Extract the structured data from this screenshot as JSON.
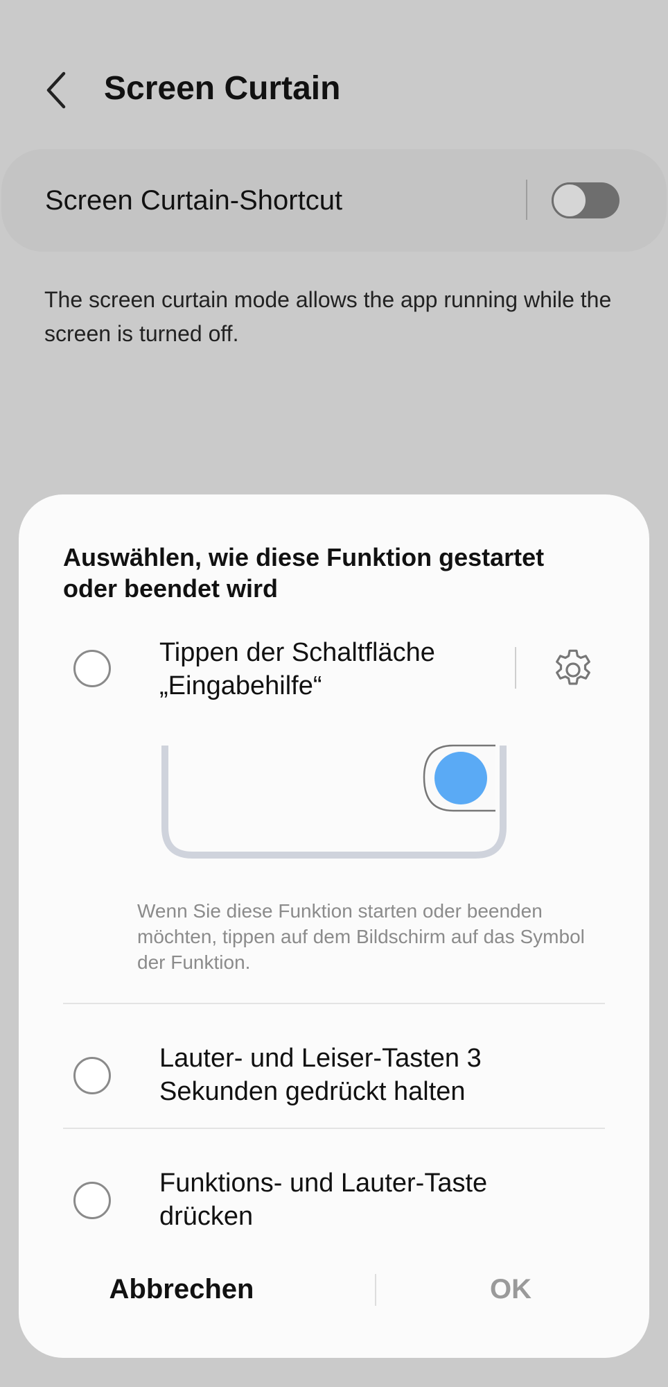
{
  "header": {
    "title": "Screen Curtain",
    "back_icon": "chevron-left-icon"
  },
  "shortcut": {
    "label": "Screen Curtain-Shortcut",
    "toggle_on": false
  },
  "description": "The screen curtain mode allows the app running while the screen is turned off.",
  "dialog": {
    "title": "Auswählen, wie diese Funktion gestartet oder beendet wird",
    "options": [
      {
        "label": "Tippen der Schaltfläche „Eingabehilfe“",
        "selected": false,
        "settings_icon": "gear-icon",
        "hint": "Wenn Sie diese Funktion starten oder beenden möchten, tippen auf dem Bildschirm auf das Symbol der Funktion."
      },
      {
        "label": "Lauter- und Leiser-Tasten 3 Sekunden gedrückt halten",
        "selected": false
      },
      {
        "label": "Funktions- und Lauter-Taste drücken",
        "selected": false
      }
    ],
    "cancel_label": "Abbrechen",
    "ok_label": "OK"
  },
  "colors": {
    "background": "#cacaca",
    "dialog_background": "#fbfbfb",
    "accent_blue": "#5aaaf5",
    "toggle_track": "#6e6e6e",
    "ok_disabled": "#9a9a9a"
  }
}
